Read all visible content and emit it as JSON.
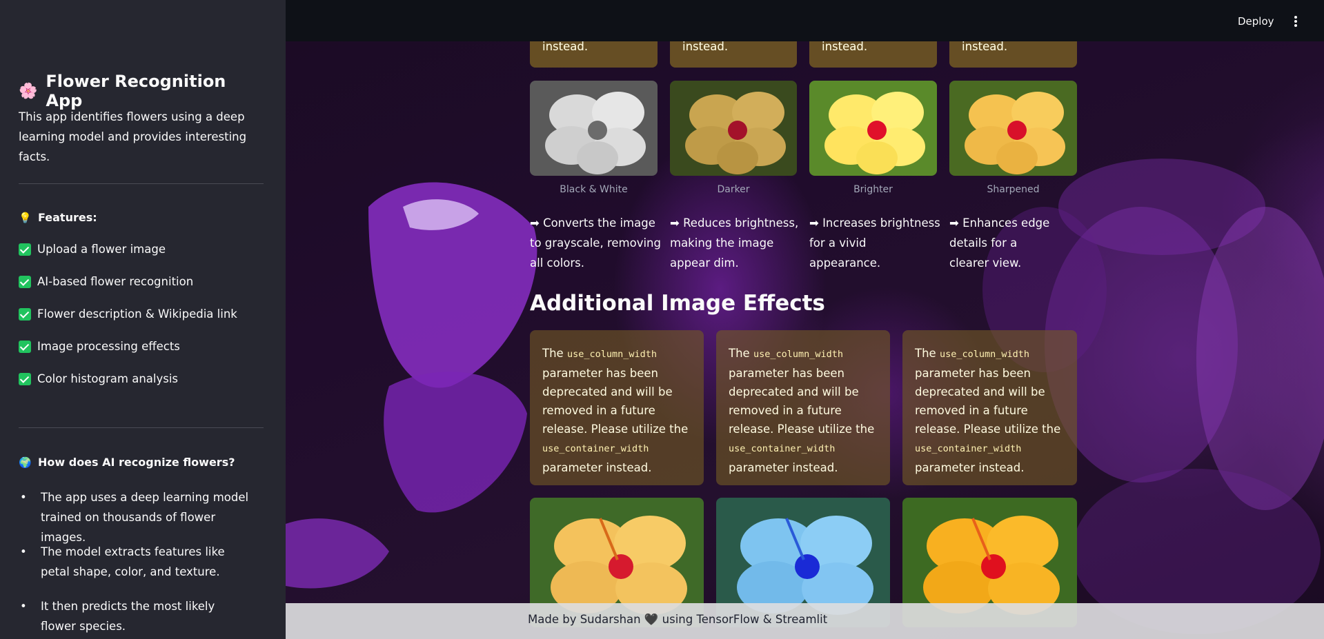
{
  "sidebar": {
    "title_emoji": "🌸",
    "title": "Flower Recognition App",
    "description": "This app identifies flowers using a deep learning model and provides interesting facts.",
    "features_icon": "💡",
    "features_heading": "Features:",
    "features": [
      "Upload a flower image",
      "AI-based flower recognition",
      "Flower description & Wikipedia link",
      "Image processing effects",
      "Color histogram analysis"
    ],
    "how_icon": "🌍",
    "how_heading": "How does AI recognize flowers?",
    "how_points": [
      "The app uses a deep learning model trained on thousands of flower images.",
      "The model extracts features like petal shape, color, and texture.",
      "It then predicts the most likely flower species."
    ]
  },
  "header": {
    "deploy_label": "Deploy",
    "menu_icon": "kebab-menu-icon"
  },
  "top_warnings": [
    "instead.",
    "instead.",
    "instead.",
    "instead."
  ],
  "filters": [
    {
      "caption": "Black & White",
      "description": "➡ Converts the image to grayscale, removing all colors."
    },
    {
      "caption": "Darker",
      "description": "➡ Reduces brightness, making the image appear dim."
    },
    {
      "caption": "Brighter",
      "description": "➡ Increases brightness for a vivid appearance."
    },
    {
      "caption": "Sharpened",
      "description": "➡ Enhances edge details for a clearer view."
    }
  ],
  "additional_heading": "Additional Image Effects",
  "deprecation_warning": {
    "the": "The",
    "code1": "use_column_width",
    "middle": "parameter has been deprecated and will be removed in a future release. Please utilize the",
    "code2": "use_container_width",
    "end": "parameter instead."
  },
  "footer": {
    "text": "Made by Sudarshan 🖤 using TensorFlow & Streamlit"
  },
  "colors": {
    "sidebar_bg": "#262730",
    "topbar_bg": "#0e1117",
    "check_green": "#21c35e",
    "warning_bg": "#735a23"
  }
}
